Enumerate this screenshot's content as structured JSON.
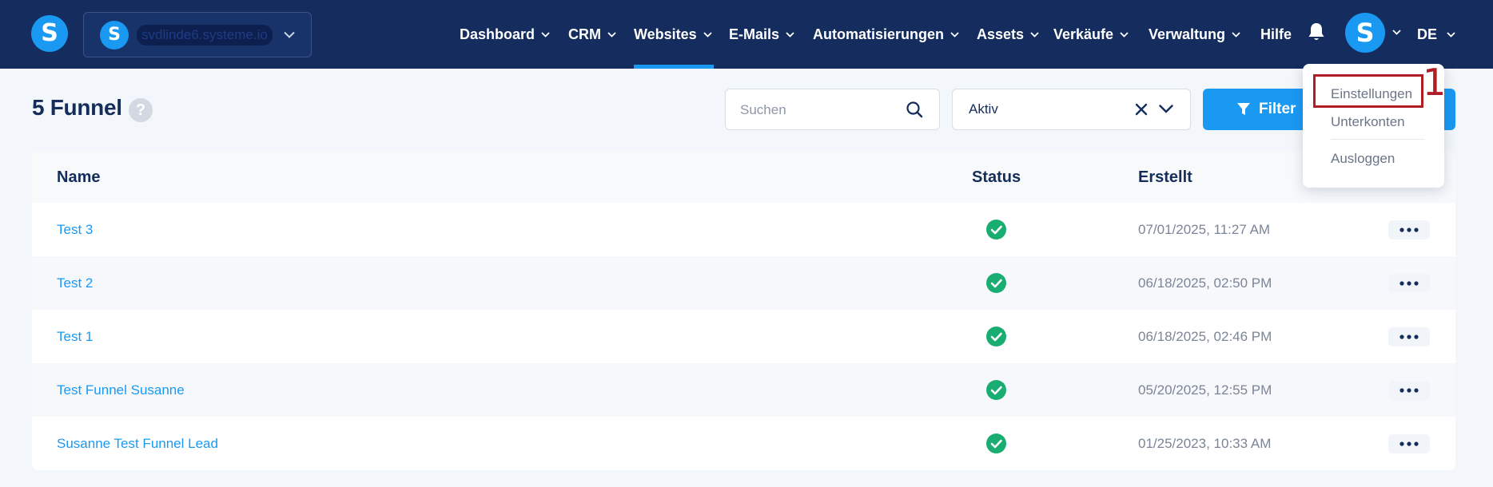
{
  "brand": {
    "logo_letter": "S",
    "accent": "#1a99f2",
    "nav_bg": "#142d5e"
  },
  "account": {
    "logo_letter": "S",
    "name": "svdlinde6.systeme.io"
  },
  "nav": {
    "items": [
      {
        "label": "Dashboard",
        "dropdown": true
      },
      {
        "label": "CRM",
        "dropdown": true
      },
      {
        "label": "Websites",
        "dropdown": true,
        "active": true
      },
      {
        "label": "E-Mails",
        "dropdown": true
      },
      {
        "label": "Automatisierungen",
        "dropdown": true
      },
      {
        "label": "Assets",
        "dropdown": true
      },
      {
        "label": "Verkäufe",
        "dropdown": true
      },
      {
        "label": "Verwaltung",
        "dropdown": true
      },
      {
        "label": "Hilfe",
        "dropdown": false
      }
    ],
    "avatar_letter": "S",
    "language": "DE"
  },
  "page": {
    "title": "5 Funnel",
    "help_icon": "?"
  },
  "search": {
    "placeholder": "Suchen",
    "value": ""
  },
  "status_filter": {
    "selected": "Aktiv"
  },
  "filter_button": {
    "label": "Filter"
  },
  "table": {
    "columns": {
      "name": "Name",
      "status": "Status",
      "created": "Erstellt"
    },
    "rows": [
      {
        "name": "Test 3",
        "status": "active",
        "created": "07/01/2025, 11:27 AM"
      },
      {
        "name": "Test 2",
        "status": "active",
        "created": "06/18/2025, 02:50 PM"
      },
      {
        "name": "Test 1",
        "status": "active",
        "created": "06/18/2025, 02:46 PM"
      },
      {
        "name": "Test Funnel Susanne",
        "status": "active",
        "created": "05/20/2025, 12:55 PM"
      },
      {
        "name": "Susanne Test Funnel Lead",
        "status": "active",
        "created": "01/25/2023, 10:33 AM"
      }
    ]
  },
  "user_menu": {
    "items": [
      "Einstellungen",
      "Unterkonten",
      "Ausloggen"
    ]
  },
  "annotation": {
    "label": "1",
    "color": "#b01d24"
  }
}
